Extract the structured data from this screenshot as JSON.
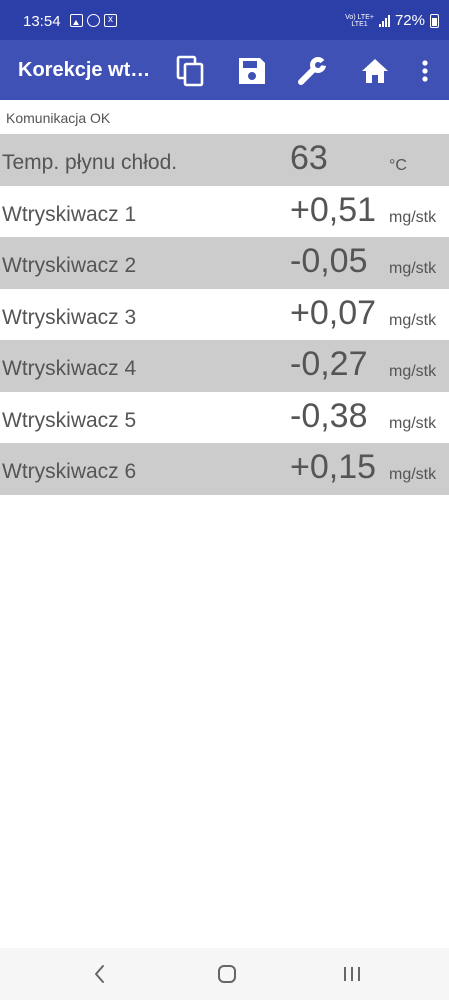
{
  "status_bar": {
    "time": "13:54",
    "network_label_1": "Vo) LTE+",
    "network_label_2": "LTE1",
    "battery": "72%",
    "icons": [
      "image-icon",
      "whatsapp-icon",
      "app-icon",
      "signal-icon",
      "battery-icon"
    ]
  },
  "app_bar": {
    "title": "Korekcje wt…",
    "actions": [
      "copy-icon",
      "save-icon",
      "wrench-icon",
      "home-icon",
      "overflow-menu-icon"
    ]
  },
  "communication_status": "Komunikacja OK",
  "rows": [
    {
      "label": "Temp. płynu chłod.",
      "value": "63",
      "unit": "°C"
    },
    {
      "label": "Wtryskiwacz 1",
      "value": "+0,51",
      "unit": "mg/stk"
    },
    {
      "label": "Wtryskiwacz 2",
      "value": "-0,05",
      "unit": "mg/stk"
    },
    {
      "label": "Wtryskiwacz 3",
      "value": "+0,07",
      "unit": "mg/stk"
    },
    {
      "label": "Wtryskiwacz 4",
      "value": "-0,27",
      "unit": "mg/stk"
    },
    {
      "label": "Wtryskiwacz 5",
      "value": "-0,38",
      "unit": "mg/stk"
    },
    {
      "label": "Wtryskiwacz 6",
      "value": "+0,15",
      "unit": "mg/stk"
    }
  ],
  "navigation": [
    "back-icon",
    "home-nav-icon",
    "recents-icon"
  ],
  "colors": {
    "status_bar": "#2c3fa8",
    "app_bar": "#3f51b5",
    "row_shade": "#cccccc",
    "text": "#555555"
  }
}
